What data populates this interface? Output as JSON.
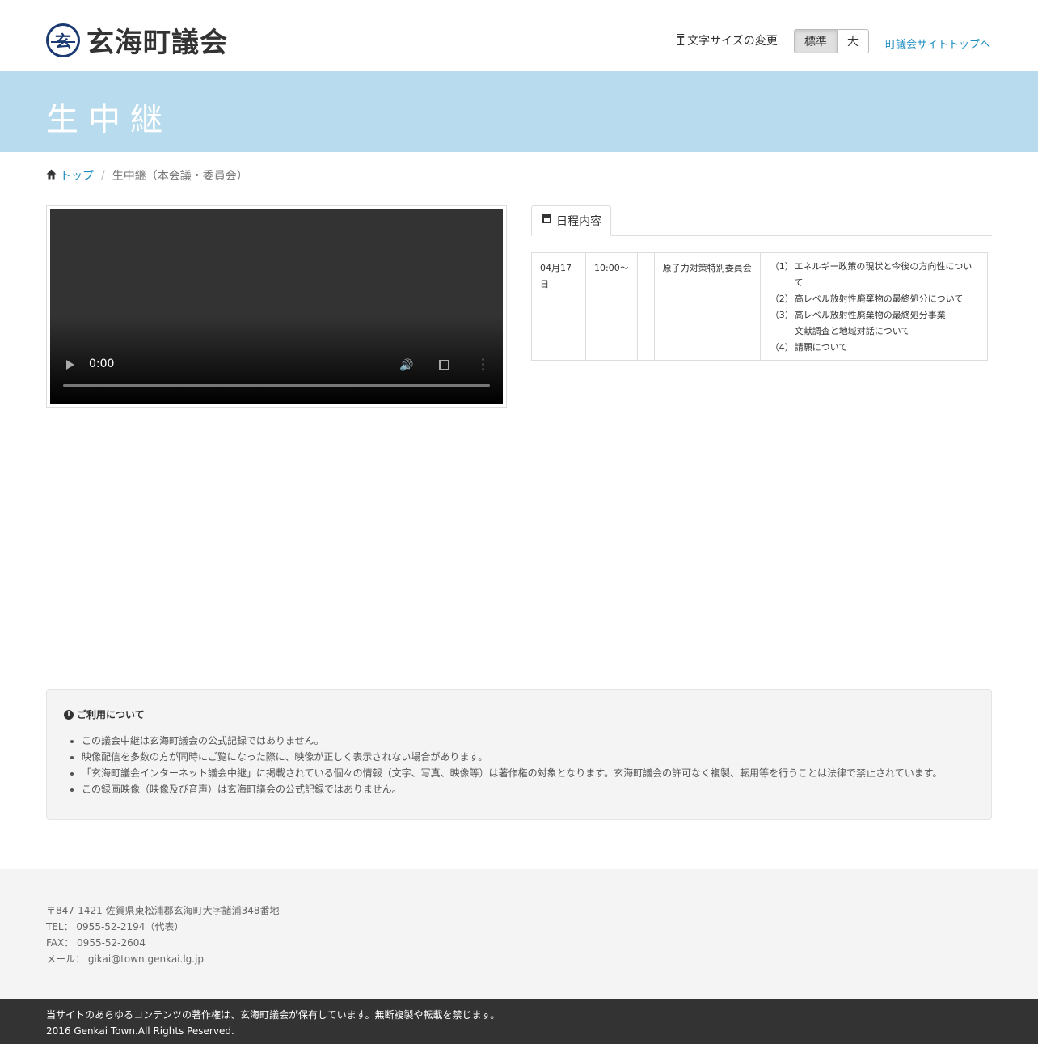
{
  "header": {
    "logo_text": "玄海町議会",
    "logo_mark": "玄",
    "font_size_label": "文字サイズの変更",
    "size_normal": "標準",
    "size_large": "大",
    "top_link": "町議会サイトトップへ"
  },
  "banner": {
    "title": "生中継"
  },
  "breadcrumb": {
    "home": "トップ",
    "current": "生中継（本会議・委員会）"
  },
  "video": {
    "time": "0:00",
    "progress": 0
  },
  "schedule": {
    "tab_label": "日程内容",
    "rows": [
      {
        "date": "04月17日",
        "time": "10:00〜",
        "extra": "",
        "committee": "原子力対策特別委員会",
        "items": [
          {
            "num": "（1）",
            "text": "エネルギー政策の現状と今後の方向性について"
          },
          {
            "num": "（2）",
            "text": "高レベル放射性廃棄物の最終処分について"
          },
          {
            "num": "（3）",
            "text": "高レベル放射性廃棄物の最終処分事業"
          },
          {
            "num": "",
            "text": "文献調査と地域対話について"
          },
          {
            "num": "（4）",
            "text": "請願について"
          }
        ]
      }
    ]
  },
  "notice": {
    "title": "ご利用について",
    "items": [
      "この議会中継は玄海町議会の公式記録ではありません。",
      "映像配信を多数の方が同時にご覧になった際に、映像が正しく表示されない場合があります。",
      "「玄海町議会インターネット議会中継」に掲載されている個々の情報（文字、写真、映像等）は著作権の対象となります。玄海町議会の許可なく複製、転用等を行うことは法律で禁止されています。",
      "この録画映像（映像及び音声）は玄海町議会の公式記録ではありません。"
    ]
  },
  "footer": {
    "address": "〒847-1421 佐賀県東松浦郡玄海町大字諸浦348番地",
    "tel": "TEL： 0955-52-2194（代表）",
    "fax": "FAX： 0955-52-2604",
    "mail": "メール： gikai@town.genkai.lg.jp"
  },
  "copyright": {
    "notice": "当サイトのあらゆるコンテンツの著作権は、玄海町議会が保有しています。無断複製や転載を禁じます。",
    "rights": "2016 Genkai Town.All Rights Peserved."
  },
  "colors": {
    "banner": "#b8dcee",
    "link": "#1a8cc0",
    "footer_dark": "#333333"
  }
}
